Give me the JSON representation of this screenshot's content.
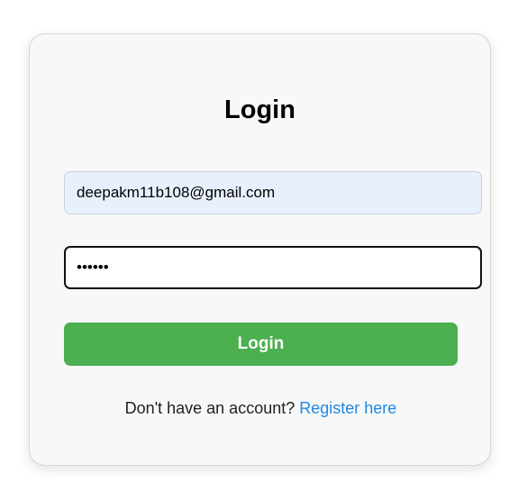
{
  "login_form": {
    "title": "Login",
    "email": {
      "value": "deepakm11b108@gmail.com",
      "type": "email"
    },
    "password": {
      "value": "••••••",
      "type": "password"
    },
    "submit_label": "Login",
    "register_prompt": "Don't have an account?",
    "register_link_label": "Register here"
  },
  "colors": {
    "card_background": "#f8f8f8",
    "email_autofill_background": "#e8f0fe",
    "button_background": "#4caf50",
    "button_text": "#ffffff",
    "link": "#1e88e5"
  }
}
